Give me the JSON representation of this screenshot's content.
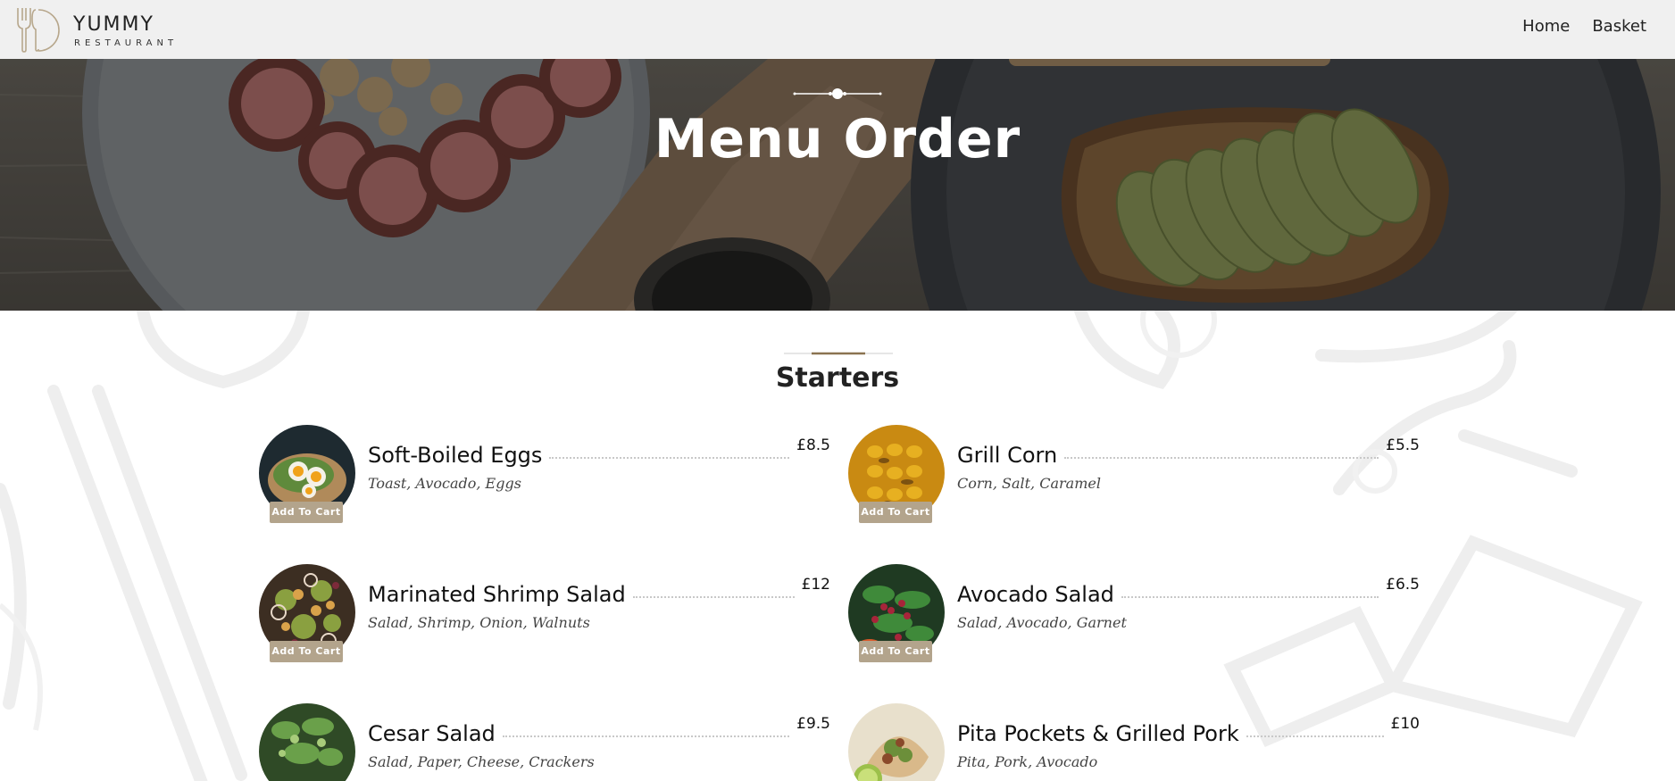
{
  "header": {
    "brand": "YUMMY",
    "brand_sub": "RESTAURANT",
    "nav": [
      {
        "label": "Home"
      },
      {
        "label": "Basket"
      }
    ]
  },
  "hero": {
    "title": "Menu Order"
  },
  "section": {
    "title": "Starters",
    "add_to_cart_label": "Add To Cart",
    "items": [
      {
        "name": "Soft-Boiled Eggs",
        "price": "£8.5",
        "description": "Toast, Avocado, Eggs"
      },
      {
        "name": "Grill Corn",
        "price": "£5.5",
        "description": "Corn, Salt, Caramel"
      },
      {
        "name": "Marinated Shrimp Salad",
        "price": "£12",
        "description": "Salad, Shrimp, Onion, Walnuts"
      },
      {
        "name": "Avocado Salad",
        "price": "£6.5",
        "description": "Salad, Avocado, Garnet"
      },
      {
        "name": "Cesar Salad",
        "price": "£9.5",
        "description": "Salad, Paper, Cheese, Crackers"
      },
      {
        "name": "Pita Pockets & Grilled Pork",
        "price": "£10",
        "description": "Pita, Pork, Avocado"
      }
    ]
  },
  "colors": {
    "header_bg": "#f0f0f0",
    "accent": "#8a7350",
    "button_bg": "#b3a48c"
  }
}
